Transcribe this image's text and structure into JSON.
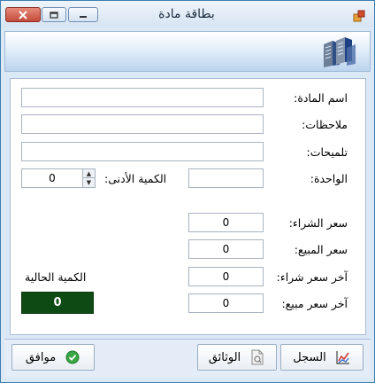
{
  "window": {
    "title": "بطاقة مادة"
  },
  "form": {
    "name_label": "اسم المادة:",
    "notes_label": "ملاحظات:",
    "hints_label": "تلميحات:",
    "unit_label": "الواحدة:",
    "min_qty_label": "الكمية الأدنى:",
    "min_qty_value": "0",
    "purchase_price_label": "سعر الشراء:",
    "purchase_price_value": "0",
    "sale_price_label": "سعر المبيع:",
    "sale_price_value": "0",
    "last_purchase_price_label": "آخر سعر شراء:",
    "last_purchase_price_value": "0",
    "last_sale_price_label": "آخر سعر مبيع:",
    "last_sale_price_value": "0",
    "current_qty_label": "الكمية الحالية",
    "current_qty_value": "0"
  },
  "footer": {
    "ok_label": "موافق",
    "documents_label": "الوثائق",
    "log_label": "السجل"
  }
}
